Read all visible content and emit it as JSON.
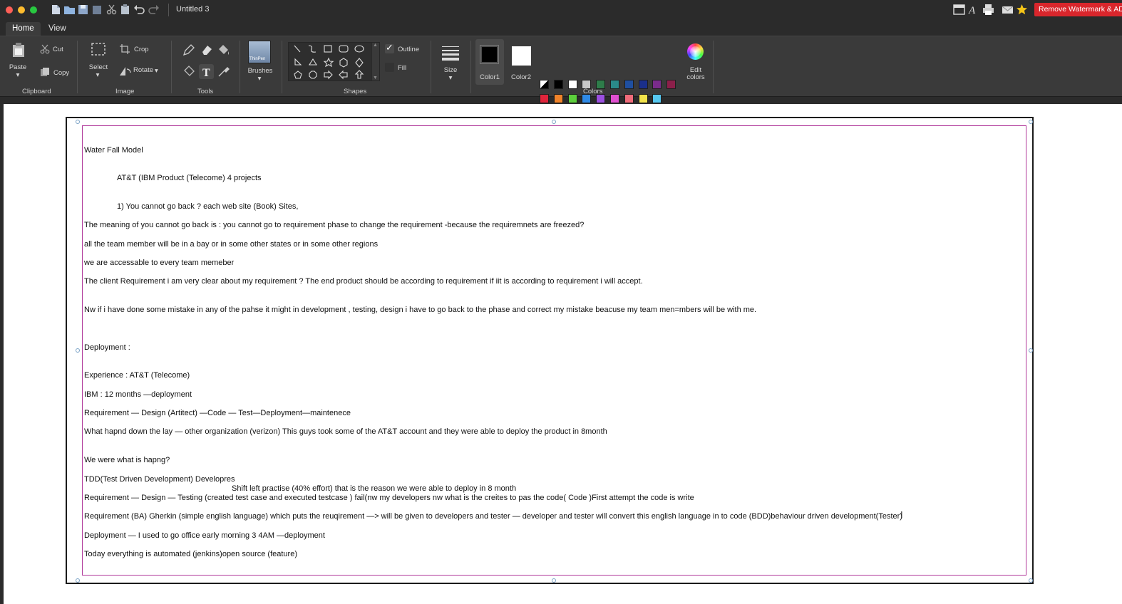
{
  "window": {
    "title": "Untitled 3",
    "watermark_button": "Remove Watermark & AD"
  },
  "tabs": [
    "Home",
    "View"
  ],
  "clipboard": {
    "paste": "Paste",
    "cut": "Cut",
    "copy": "Copy",
    "section": "Clipboard"
  },
  "image": {
    "select": "Select",
    "crop": "Crop",
    "rotate": "Rotate",
    "section": "Image"
  },
  "tools": {
    "section": "Tools"
  },
  "brushes": {
    "label": "Brushes",
    "thumb": "ThinPen"
  },
  "shapes": {
    "outline": "Outline",
    "fill": "Fill",
    "section": "Shapes"
  },
  "size": {
    "label": "Size"
  },
  "colors": {
    "color1": "Color1",
    "color2": "Color2",
    "edit": "Edit colors",
    "section": "Colors",
    "color1_value": "#000000",
    "color2_value": "#ffffff",
    "palette_row1": [
      "#000000",
      "#ffffff",
      "#c8c8c8",
      "#2e7d4a",
      "#2a8a8a",
      "#1f4fa0",
      "#1a2f8c",
      "#7a2b8c",
      "#8c1f4a"
    ],
    "palette_row2": [
      "#e0243b",
      "#f0832a",
      "#5ccf3c",
      "#2f8ae6",
      "#9b4fe0",
      "#e04fd0",
      "#f06b7a",
      "#f2e34a",
      "#56c8f0"
    ]
  },
  "document": {
    "lines": [
      "Water Fall Model",
      "AT&T (IBM Product (Telecome) 4 projects",
      "1) You cannot go back ? each web site (Book) Sites,",
      "The meaning of you cannot go back is : you cannot  go to requirement phase to change the requirement -because the requiremnets are freezed?",
      "all the team member will be in a bay or in some other states or in some other regions",
      "we are accessable to every team memeber",
      "The client Requirement i am very clear about my requirement ? The end product should be according to requirement if iit is according to requirement i will accept.",
      "Nw if i have done some mistake in any of the pahse it might in development , testing, design i have to go back to the phase and correct my mistake beacuse my team men=mbers will be with me.",
      "Deployment :",
      "Experience : AT&T (Telecome)",
      "IBM : 12 months —deployment",
      "Requirement — Design (Artitect) —Code — Test—Deployment—maintenece",
      "What hapnd down the lay — other organization (verizon) This guys took some of the AT&T account  and they were able to deploy the product in 8month",
      "We were what is hapng?",
      "TDD(Test Driven Development) Developres",
      "Shift left practise (40% effort) that is the reason we were able to deploy in 8 month",
      "Requirement — Design — Testing (created test case and executed testcase ) fail(nw my developers nw what is the creites to pas the code( Code )First attempt the code is write",
      "Requirement (BA) Gherkin (simple english language) which puts the reuqirement —> will be given to developers and tester — developer and tester will convert this english language in to code (BDD)behaviour driven development(Tester)",
      "Deployment — I used to go office early morning 3 4AM —deployment",
      "Today everything is automated  (jenkins)open source (feature)"
    ]
  }
}
